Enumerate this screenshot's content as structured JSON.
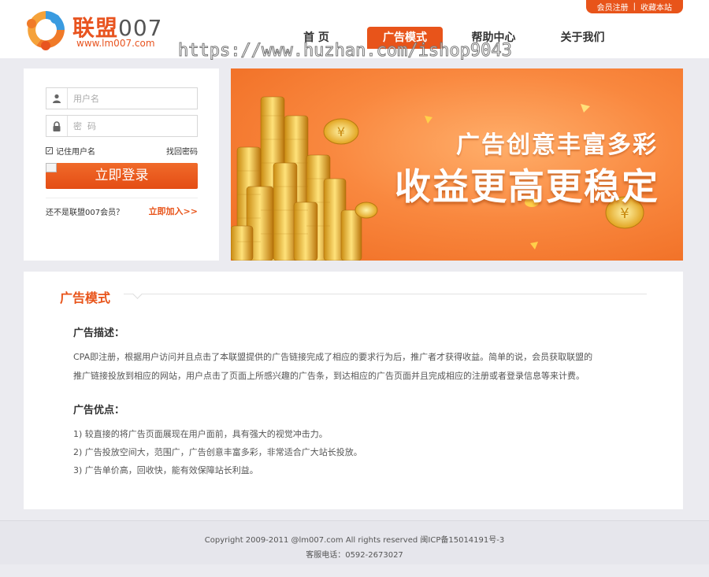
{
  "header": {
    "top_links": [
      "会员注册",
      "|",
      "收藏本站"
    ],
    "logo": {
      "name_cn": "联盟",
      "name_num": "007",
      "url": "www.lm007.com"
    },
    "nav": [
      {
        "label": "首 页",
        "active": false
      },
      {
        "label": "广告模式",
        "active": true
      },
      {
        "label": "帮助中心",
        "active": false
      },
      {
        "label": "关于我们",
        "active": false
      }
    ],
    "watermark": "https://www.huzhan.com/ishop9043"
  },
  "login": {
    "username_placeholder": "用户名",
    "password_placeholder": "密  码",
    "remember_label": "记住用户名",
    "remember_checked": true,
    "forgot_label": "找回密码",
    "submit_label": "立即登录",
    "not_member_text": "还不是联盟007会员？",
    "join_label": "立即加入>>",
    "user_icon": "user-icon",
    "lock_icon": "lock-icon"
  },
  "banner": {
    "line1": "广告创意丰富多彩",
    "line2": "收益更高更稳定"
  },
  "content": {
    "title": "广告模式",
    "sections": [
      {
        "heading": "广告描述：",
        "lines": [
          "CPA即注册，根据用户访问并且点击了本联盟提供的广告链接完成了相应的要求行为后，推广者才获得收益。简单的说，会员获取联盟的",
          "推广链接投放到相应的网站，用户点击了页面上所感兴趣的广告条，到达相应的广告页面并且完成相应的注册或者登录信息等来计费。"
        ]
      },
      {
        "heading": "广告优点：",
        "lines": [
          "1) 较直接的将广告页面展现在用户面前，具有强大的视觉冲击力。",
          "2) 广告投放空间大，范围广，广告创意丰富多彩，非常适合广大站长投放。",
          "3) 广告单价高，回收快，能有效保障站长利益。"
        ]
      }
    ]
  },
  "footer": {
    "copyright": "Copyright 2009-2011 @lm007.com All rights reserved 闽ICP备15014191号-3",
    "phone": "客服电话：0592-2673027"
  },
  "colors": {
    "accent": "#e8541a",
    "page_bg": "#ebebf0"
  }
}
